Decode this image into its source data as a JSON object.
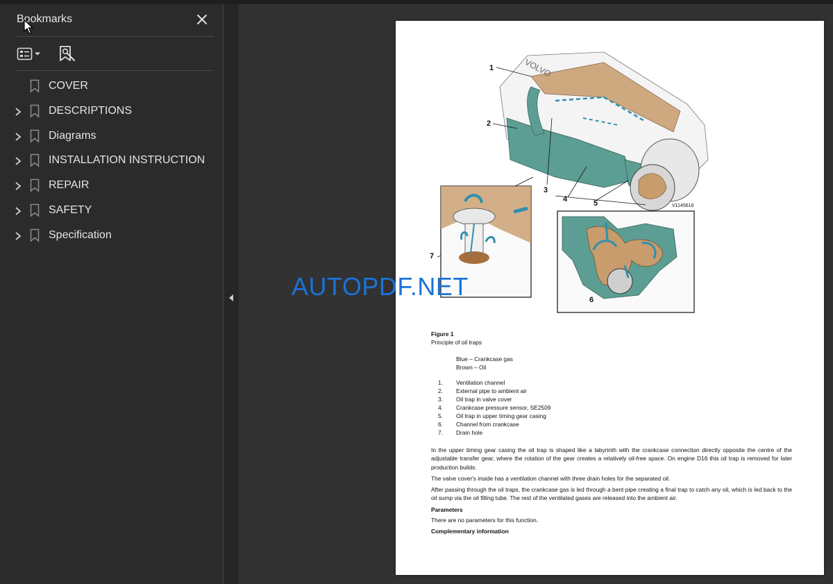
{
  "sidebar": {
    "title": "Bookmarks",
    "close_icon": "close-icon",
    "toolbar": {
      "options_icon": "list-options-icon",
      "find_icon": "find-bookmark-icon"
    },
    "items": [
      {
        "label": "COVER",
        "expandable": false
      },
      {
        "label": "DESCRIPTIONS",
        "expandable": true
      },
      {
        "label": "Diagrams",
        "expandable": true
      },
      {
        "label": "INSTALLATION INSTRUCTION",
        "expandable": true
      },
      {
        "label": "REPAIR",
        "expandable": true
      },
      {
        "label": "SAFETY",
        "expandable": true
      },
      {
        "label": "Specification",
        "expandable": true
      }
    ]
  },
  "document": {
    "figure": {
      "callouts": [
        "1",
        "2",
        "3",
        "4",
        "5",
        "6",
        "7"
      ],
      "code": "V1145616",
      "brand_text": "VOLVO"
    },
    "caption_title": "Figure 1",
    "caption_sub": "Principle of oil traps",
    "legend": [
      "Blue – Crankcase gas",
      "Brown – Oil"
    ],
    "list": [
      {
        "num": "1.",
        "text": "Ventilation channel"
      },
      {
        "num": "2.",
        "text": "External pipe to ambient air"
      },
      {
        "num": "3.",
        "text": "Oil trap in valve cover"
      },
      {
        "num": "4.",
        "text": "Crankcase pressure sensor, SE2509"
      },
      {
        "num": "5.",
        "text": "Oil trap in upper timing gear casing"
      },
      {
        "num": "6.",
        "text": "Channel from crankcase"
      },
      {
        "num": "7.",
        "text": "Drain hole"
      }
    ],
    "para1": "In the upper timing gear casing the oil trap is shaped like a labyrinth with the crankcase connection directly opposite the centre of the adjustable transfer gear, where the rotation of the gear creates a relatively oil-free space. On engine D16 this oil trap is removed for later production builds.",
    "para2": "The valve cover's inside has a ventilation channel with three drain holes for the separated oil.",
    "para3": "After passing through the oil traps, the crankcase gas is led through a bent pipe creating a final trap to catch any oil, which is led back to the oil sump via the oil filling tube. The rest of the ventilated gases are released into the ambient air.",
    "heading_params": "Parameters",
    "params_text": "There are no parameters for this function.",
    "heading_comp": "Complementary information"
  },
  "watermark": "AUTOPDF.NET",
  "colors": {
    "gas_blue": "#2f8fb0",
    "oil_brown": "#b98a5a",
    "engine_teal": "#5c9e93",
    "watermark": "#1a73d9"
  }
}
